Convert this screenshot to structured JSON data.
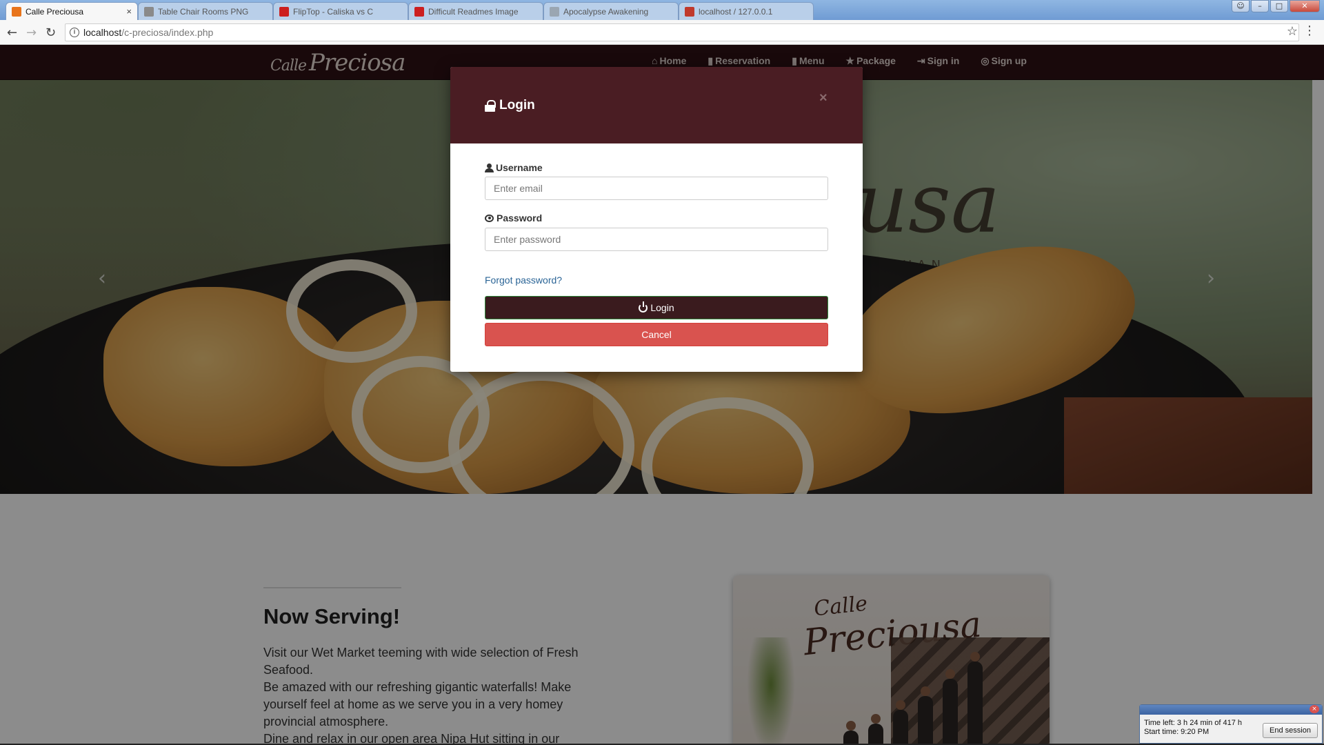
{
  "browser": {
    "tabs": [
      {
        "title": "Calle Preciousa",
        "active": true,
        "favicon_color": "#e8741b"
      },
      {
        "title": "Table Chair Rooms PNG",
        "active": false,
        "favicon_color": "#8a8a8a"
      },
      {
        "title": "FlipTop - Caliska vs C",
        "active": false,
        "favicon_color": "#cc1f1f"
      },
      {
        "title": "Difficult Readmes Image",
        "active": false,
        "favicon_color": "#cc1f1f"
      },
      {
        "title": "Apocalypse Awakening",
        "active": false,
        "favicon_color": "#9aa6b2"
      },
      {
        "title": "localhost / 127.0.0.1",
        "active": false,
        "favicon_color": "#c0392b"
      }
    ],
    "tab_close_glyph": "×",
    "url_host": "localhost",
    "url_path": "/c-preciosa/index.php"
  },
  "site": {
    "brand": "Preciosa",
    "brand_small": "Calle",
    "nav": [
      {
        "label": "Home",
        "icon": "home-icon"
      },
      {
        "label": "Reservation",
        "icon": "book-icon"
      },
      {
        "label": "Menu",
        "icon": "bookmark-icon"
      },
      {
        "label": "Package",
        "icon": "star-icon"
      },
      {
        "label": "Sign in",
        "icon": "sign-in-icon"
      },
      {
        "label": "Sign up",
        "icon": "user-circle-icon"
      }
    ],
    "hero_sign": "usa",
    "hero_sub": "TUAN",
    "prev_glyph": "‹",
    "next_glyph": "›"
  },
  "main": {
    "heading": "Now Serving!",
    "paragraphs": [
      "Visit our Wet Market teeming with wide selection of Fresh Seafood.",
      "Be amazed with our refreshing gigantic waterfalls! Make yourself feel at home as we serve you in a very homey provincial atmosphere.",
      "Dine and relax in our open area Nipa Hut sitting in our garden with your family and friends!"
    ],
    "photo_sign_small": "Calle",
    "photo_sign": "Preciousa"
  },
  "modal": {
    "title": "Login",
    "close_glyph": "×",
    "username_label": "Username",
    "username_placeholder": "Enter email",
    "password_label": "Password",
    "password_placeholder": "Enter password",
    "forgot_link": "Forgot password?",
    "login_button": "Login",
    "cancel_button": "Cancel"
  },
  "session": {
    "time_left": "Time left: 3 h 24 min of 417 h",
    "start_time": "Start time: 9:20 PM",
    "end_button": "End session",
    "close_glyph": "×"
  },
  "colors": {
    "navbar": "#2e1215",
    "modal_header": "#4a1d23",
    "login_button": "#3a1b1e",
    "cancel_button": "#d9534f",
    "link": "#2a6496"
  }
}
